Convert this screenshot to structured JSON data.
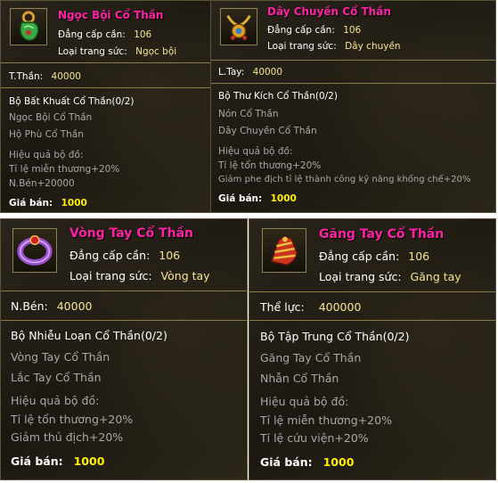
{
  "cards": [
    {
      "title": "Ngọc Bội Cổ Thần",
      "level_label": "Đẳng cấp cần:",
      "level_value": "106",
      "type_label": "Loại trang sức:",
      "type_value": "Ngọc bội",
      "stat_label": "T.Thần:",
      "stat_value": "40000",
      "set_name": "Bộ Bất Khuất Cổ Thần(0/2)",
      "set_items": [
        "Ngọc Bội Cổ Thần",
        "Hộ Phù Cổ Thần"
      ],
      "effect_title": "Hiệu quả bộ đồ:",
      "effects": [
        "Tỉ lệ miễn thương+20%",
        "N.Bén+20000"
      ],
      "price_label": "Giá bán:",
      "price_value": "1000",
      "icon": "jade-pendant-icon"
    },
    {
      "title": "Dây Chuyền Cổ Thần",
      "level_label": "Đẳng cấp cần:",
      "level_value": "106",
      "type_label": "Loại trang sức:",
      "type_value": "Dây chuyền",
      "stat_label": "L.Tay:",
      "stat_value": "40000",
      "set_name": "Bộ Thư Kích Cổ Thần(0/2)",
      "set_items": [
        "Nón Cổ Thần",
        "Dây Chuyền Cổ Thần"
      ],
      "effect_title": "Hiệu quả bộ đồ:",
      "effects": [
        "Tỉ lệ tổn thương+20%",
        "Giảm phe địch tỉ lệ thành công kỹ năng khống chế+20%"
      ],
      "price_label": "Giá bán:",
      "price_value": "1000",
      "icon": "necklace-icon"
    },
    {
      "title": "Vòng Tay Cổ Thần",
      "level_label": "Đẳng cấp cần:",
      "level_value": "106",
      "type_label": "Loại trang sức:",
      "type_value": "Vòng tay",
      "stat_label": "N.Bén:",
      "stat_value": "40000",
      "set_name": "Bộ Nhiễu Loạn Cổ Thần(0/2)",
      "set_items": [
        "Vòng Tay Cổ Thần",
        "Lắc Tay Cổ Thần"
      ],
      "effect_title": "Hiệu quả bộ đồ:",
      "effects": [
        "Tỉ lệ tổn thương+20%",
        "Giảm thủ địch+20%"
      ],
      "price_label": "Giá bán:",
      "price_value": "1000",
      "icon": "bracelet-icon"
    },
    {
      "title": "Găng Tay Cổ Thần",
      "level_label": "Đẳng cấp cần:",
      "level_value": "106",
      "type_label": "Loại trang sức:",
      "type_value": "Găng tay",
      "stat_label": "Thể lực:",
      "stat_value": "400000",
      "set_name": "Bộ Tập Trung Cổ Thần(0/2)",
      "set_items": [
        "Găng Tay Cổ Thần",
        "Nhẫn Cổ Thần"
      ],
      "effect_title": "Hiệu quả bộ đồ:",
      "effects": [
        "Tỉ lệ miễn thương+20%",
        "Tỉ lệ cứu viện+20%"
      ],
      "price_label": "Giá bán:",
      "price_value": "1000",
      "icon": "gauntlet-icon"
    }
  ]
}
